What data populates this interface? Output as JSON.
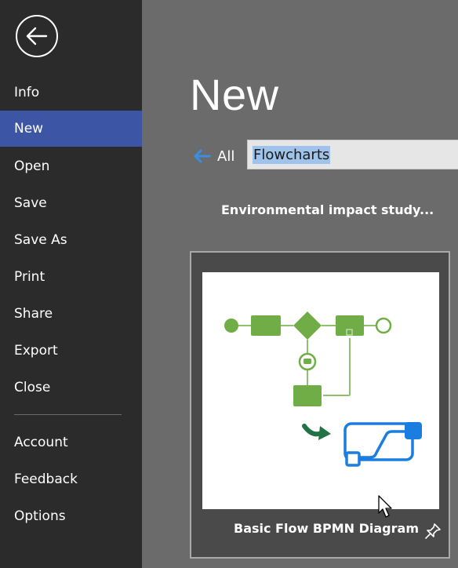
{
  "sidebar": {
    "items": [
      {
        "label": "Info"
      },
      {
        "label": "New"
      },
      {
        "label": "Open"
      },
      {
        "label": "Save"
      },
      {
        "label": "Save As"
      },
      {
        "label": "Print"
      },
      {
        "label": "Share"
      },
      {
        "label": "Export"
      },
      {
        "label": "Close"
      },
      {
        "label": "Account"
      },
      {
        "label": "Feedback"
      },
      {
        "label": "Options"
      }
    ],
    "active": "New"
  },
  "main": {
    "title": "New",
    "all_label": "All",
    "search_value": "Flowcharts",
    "section_title": "Environmental impact study...",
    "card": {
      "label": "Basic Flow BPMN Diagram"
    }
  },
  "colors": {
    "sidebar_bg": "#2b2b2b",
    "active_nav": "#3c55a5",
    "main_bg": "#6b6b6b",
    "flow_green": "#70ad47",
    "accent_blue": "#1a7de0"
  },
  "icons": [
    "back-arrow-icon",
    "left-arrow-icon",
    "pin-icon",
    "flowchart-icon"
  ]
}
